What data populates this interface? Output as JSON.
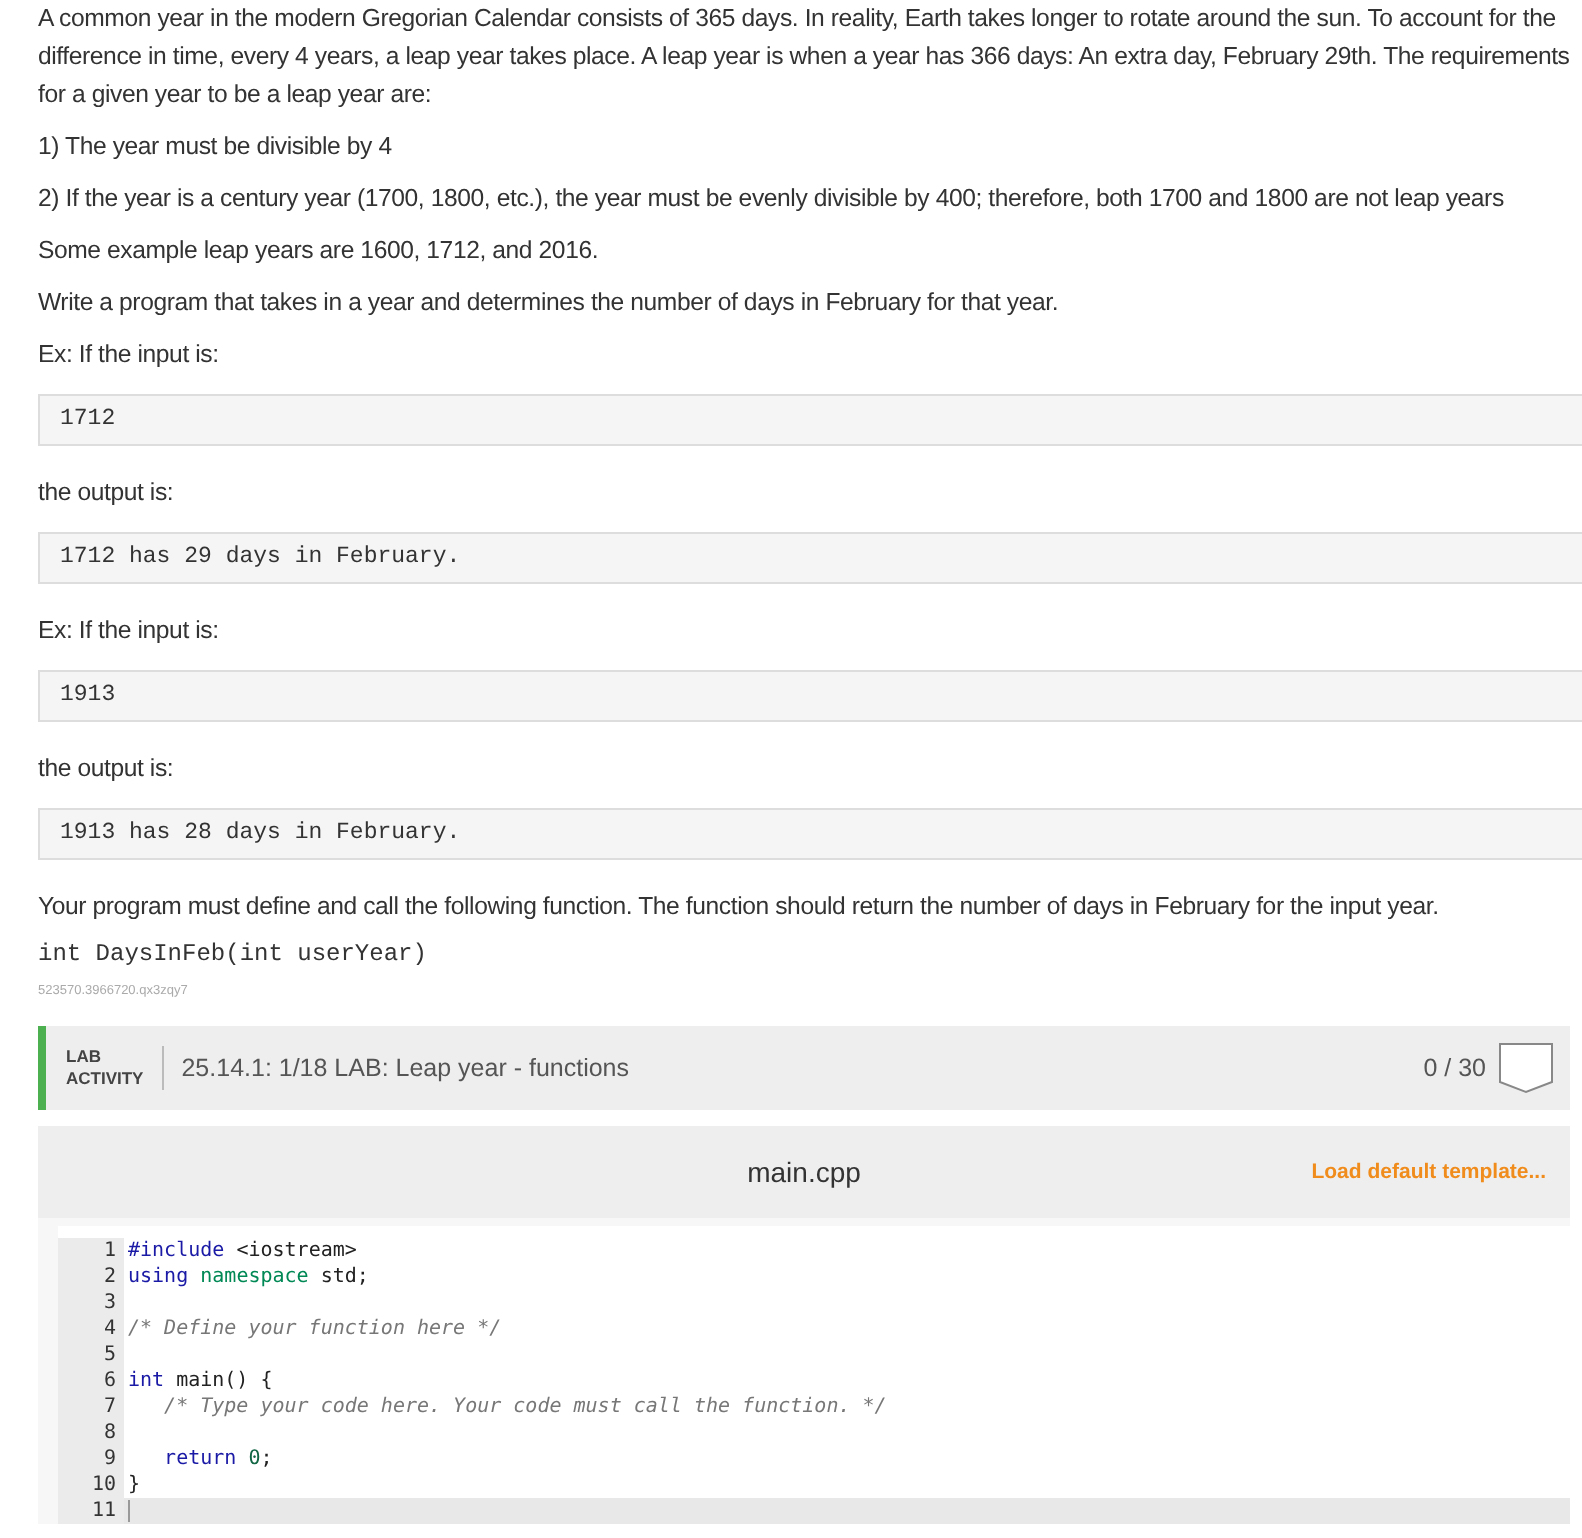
{
  "content": [
    {
      "kind": "text",
      "text": "A common year in the modern Gregorian Calendar consists of 365 days. In reality, Earth takes longer to rotate around the sun. To account for the difference in time, every 4 years, a leap year takes place. A leap year is when a year has 366 days: An extra day, February 29th. The requirements for a given year to be a leap year are:"
    },
    {
      "kind": "text",
      "text": "1) The year must be divisible by 4"
    },
    {
      "kind": "text",
      "text": "2) If the year is a century year (1700, 1800, etc.), the year must be evenly divisible by 400; therefore, both 1700 and 1800 are not leap years"
    },
    {
      "kind": "text",
      "text": "Some example leap years are 1600, 1712, and 2016."
    },
    {
      "kind": "text",
      "text": "Write a program that takes in a year and determines the number of days in February for that year."
    },
    {
      "kind": "text",
      "text": "Ex: If the input is:"
    },
    {
      "kind": "sample",
      "text": "1712"
    },
    {
      "kind": "text",
      "text": "the output is:"
    },
    {
      "kind": "sample",
      "text": "1712 has 29 days in February."
    },
    {
      "kind": "text",
      "text": "Ex: If the input is:"
    },
    {
      "kind": "sample",
      "text": "1913"
    },
    {
      "kind": "text",
      "text": "the output is:"
    },
    {
      "kind": "sample",
      "text": "1913 has 28 days in February."
    },
    {
      "kind": "text",
      "text": "Your program must define and call the following function. The function should return the number of days in February for the input year."
    },
    {
      "kind": "signature",
      "text": "int DaysInFeb(int userYear)"
    },
    {
      "kind": "id",
      "text": "523570.3966720.qx3zqy7"
    }
  ],
  "lab": {
    "badge_line_1": "LAB",
    "badge_line_2": "ACTIVITY",
    "title": "25.14.1: 1/18 LAB: Leap year - functions",
    "score": "0 / 30"
  },
  "editor": {
    "filename": "main.cpp",
    "load_link": "Load default template...",
    "lines": [
      {
        "number": "1",
        "current": false,
        "tokens": [
          {
            "kind": "keyword",
            "text": "#include"
          },
          {
            "kind": "plain",
            "text": " <iostream>"
          }
        ]
      },
      {
        "number": "2",
        "current": false,
        "tokens": [
          {
            "kind": "keyword",
            "text": "using"
          },
          {
            "kind": "type",
            "text": " namespace"
          },
          {
            "kind": "plain",
            "text": " std;"
          }
        ]
      },
      {
        "number": "3",
        "current": false
      },
      {
        "number": "4",
        "current": false,
        "tokens": [
          {
            "kind": "comment",
            "text": "/* Define your function here */"
          }
        ]
      },
      {
        "number": "5",
        "current": false
      },
      {
        "number": "6",
        "current": false,
        "tokens": [
          {
            "kind": "keyword",
            "text": "int"
          },
          {
            "kind": "plain",
            "text": " main() {"
          }
        ]
      },
      {
        "number": "7",
        "current": false,
        "tokens": [
          {
            "kind": "comment",
            "text": "   /* Type your code here. Your code must call the function. */"
          }
        ]
      },
      {
        "number": "8",
        "current": false
      },
      {
        "number": "9",
        "current": false,
        "tokens": [
          {
            "kind": "keyword",
            "text": "   return"
          },
          {
            "kind": "number",
            "text": " 0"
          },
          {
            "kind": "plain",
            "text": ";"
          }
        ]
      },
      {
        "number": "10",
        "current": false,
        "tokens": [
          {
            "kind": "plain",
            "text": "}"
          }
        ]
      },
      {
        "number": "11",
        "current": true
      }
    ]
  }
}
